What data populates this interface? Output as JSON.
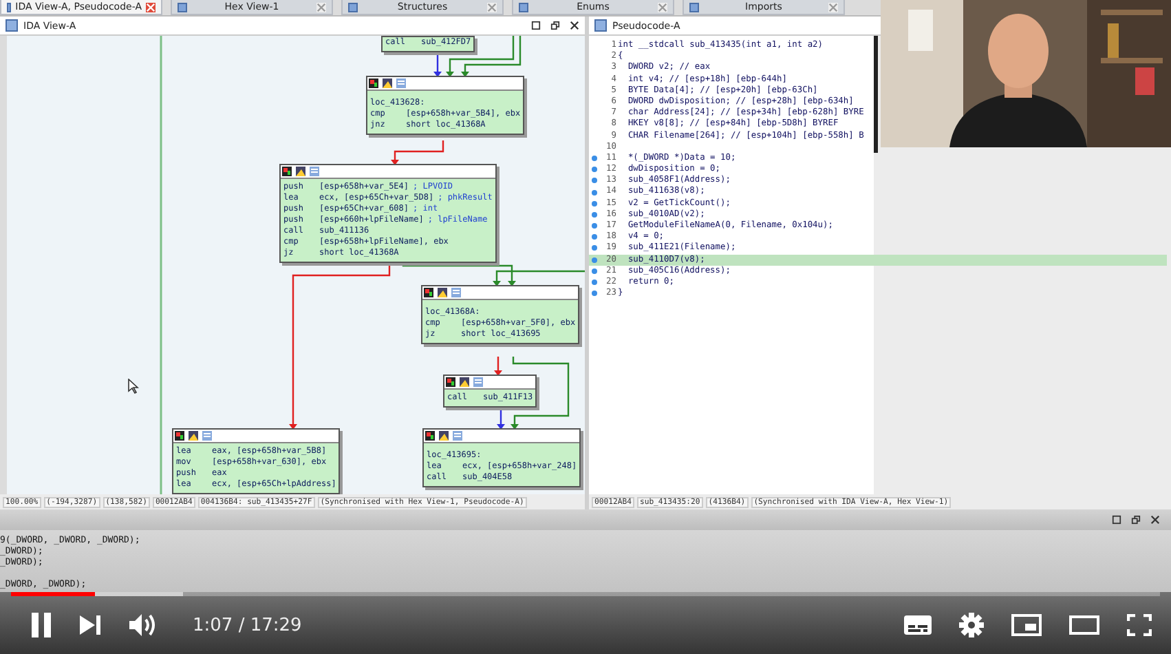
{
  "tabs": [
    {
      "label": "IDA View-A, Pseudocode-A",
      "selected": true
    },
    {
      "label": "Hex View-1",
      "selected": false
    },
    {
      "label": "Structures",
      "selected": false
    },
    {
      "label": "Enums",
      "selected": false
    },
    {
      "label": "Imports",
      "selected": false
    }
  ],
  "graph_view": {
    "title": "IDA View-A",
    "nodes": [
      {
        "lines": [
          {
            "op": "call",
            "args": "sub_412FD7"
          }
        ]
      },
      {
        "lines": [
          {
            "label": "loc_413628:"
          },
          {
            "op": "cmp",
            "args": "[esp+658h+var_5B4], ebx"
          },
          {
            "op": "jnz",
            "args": "short loc_41368A"
          }
        ]
      },
      {
        "lines": [
          {
            "op": "push",
            "args": "[esp+658h+var_5E4]",
            "comment": "; LPVOID"
          },
          {
            "op": "lea",
            "args": "ecx, [esp+65Ch+var_5D8]",
            "comment": "; phkResult"
          },
          {
            "op": "push",
            "args": "[esp+65Ch+var_608]",
            "comment": "; int"
          },
          {
            "op": "push",
            "args": "[esp+660h+lpFileName]",
            "comment": "; lpFileName"
          },
          {
            "op": "call",
            "args": "sub_411136"
          },
          {
            "op": "cmp",
            "args": "[esp+658h+lpFileName], ebx"
          },
          {
            "op": "jz",
            "args": "short loc_41368A"
          }
        ]
      },
      {
        "lines": [
          {
            "label": "loc_41368A:"
          },
          {
            "op": "cmp",
            "args": "[esp+658h+var_5F0], ebx"
          },
          {
            "op": "jz",
            "args": "short loc_413695"
          }
        ]
      },
      {
        "lines": [
          {
            "op": "call",
            "args": "sub_411F13"
          }
        ]
      },
      {
        "lines": [
          {
            "op": "lea",
            "args": "eax, [esp+658h+var_5B8]"
          },
          {
            "op": "mov",
            "args": "[esp+658h+var_630], ebx"
          },
          {
            "op": "push",
            "args": "eax"
          },
          {
            "op": "lea",
            "args": "ecx, [esp+65Ch+lpAddress]"
          }
        ]
      },
      {
        "lines": [
          {
            "label": "loc_413695:"
          },
          {
            "op": "lea",
            "args": "ecx, [esp+658h+var_248]"
          },
          {
            "op": "call",
            "args": "sub_404E58"
          }
        ]
      }
    ],
    "status": [
      "100.00%",
      "(-194,3287)",
      "(138,582)",
      "00012AB4",
      "004136B4: sub_413435+27F",
      "(Synchronised with Hex View-1, Pseudocode-A)"
    ]
  },
  "pseudocode": {
    "title": "Pseudocode-A",
    "lines": [
      {
        "num": "1",
        "text": "int __stdcall sub_413435(int a1, int a2)",
        "dot": false,
        "highlighted": false
      },
      {
        "num": "2",
        "text": "{",
        "dot": false,
        "highlighted": false
      },
      {
        "num": "3",
        "text": "  DWORD v2; // eax",
        "dot": false,
        "highlighted": false
      },
      {
        "num": "4",
        "text": "  int v4; // [esp+18h] [ebp-644h]",
        "dot": false,
        "highlighted": false
      },
      {
        "num": "5",
        "text": "  BYTE Data[4]; // [esp+20h] [ebp-63Ch]",
        "dot": false,
        "highlighted": false
      },
      {
        "num": "6",
        "text": "  DWORD dwDisposition; // [esp+28h] [ebp-634h]",
        "dot": false,
        "highlighted": false
      },
      {
        "num": "7",
        "text": "  char Address[24]; // [esp+34h] [ebp-628h] BYRE",
        "dot": false,
        "highlighted": false
      },
      {
        "num": "8",
        "text": "  HKEY v8[8]; // [esp+84h] [ebp-5D8h] BYREF",
        "dot": false,
        "highlighted": false
      },
      {
        "num": "9",
        "text": "  CHAR Filename[264]; // [esp+104h] [ebp-558h] B",
        "dot": false,
        "highlighted": false
      },
      {
        "num": "10",
        "dot": false,
        "highlighted": false
      },
      {
        "num": "11",
        "text": "  *(_DWORD *)Data = 10;",
        "dot": true,
        "highlighted": false
      },
      {
        "num": "12",
        "text": "  dwDisposition = 0;",
        "dot": true,
        "highlighted": false
      },
      {
        "num": "13",
        "text": "  sub_4058F1(Address);",
        "dot": true,
        "highlighted": false
      },
      {
        "num": "14",
        "text": "  sub_411638(v8);",
        "dot": true,
        "highlighted": false
      },
      {
        "num": "15",
        "text": "  v2 = GetTickCount();",
        "dot": true,
        "highlighted": false
      },
      {
        "num": "16",
        "text": "  sub_4010AD(v2);",
        "dot": true,
        "highlighted": false
      },
      {
        "num": "17",
        "text": "  GetModuleFileNameA(0, Filename, 0x104u);",
        "dot": true,
        "highlighted": false
      },
      {
        "num": "18",
        "text": "  v4 = 0;",
        "dot": true,
        "highlighted": false
      },
      {
        "num": "19",
        "text": "  sub_411E21(Filename);",
        "dot": true,
        "highlighted": false
      },
      {
        "num": "20",
        "text": "  sub_4110D7(v8);",
        "dot": true,
        "highlighted": true
      },
      {
        "num": "21",
        "text": "  sub_405C16(Address);",
        "dot": true,
        "highlighted": false
      },
      {
        "num": "22",
        "text": "  return 0;",
        "dot": true,
        "highlighted": false
      },
      {
        "num": "23",
        "text": "}",
        "dot": true,
        "highlighted": false
      }
    ],
    "status": [
      "00012AB4",
      "sub_413435:20",
      "(4136B4)",
      "(Synchronised with IDA View-A, Hex View-1)"
    ]
  },
  "output": {
    "lines": [
      "9(_DWORD, _DWORD, _DWORD);",
      "_DWORD);",
      "_DWORD);",
      "_DWORD, _DWORD);"
    ]
  },
  "player": {
    "playing": true,
    "progress": {
      "level": 0.073
    },
    "buffer": {
      "level": 0.15
    },
    "time": "1:07 / 17:29"
  }
}
